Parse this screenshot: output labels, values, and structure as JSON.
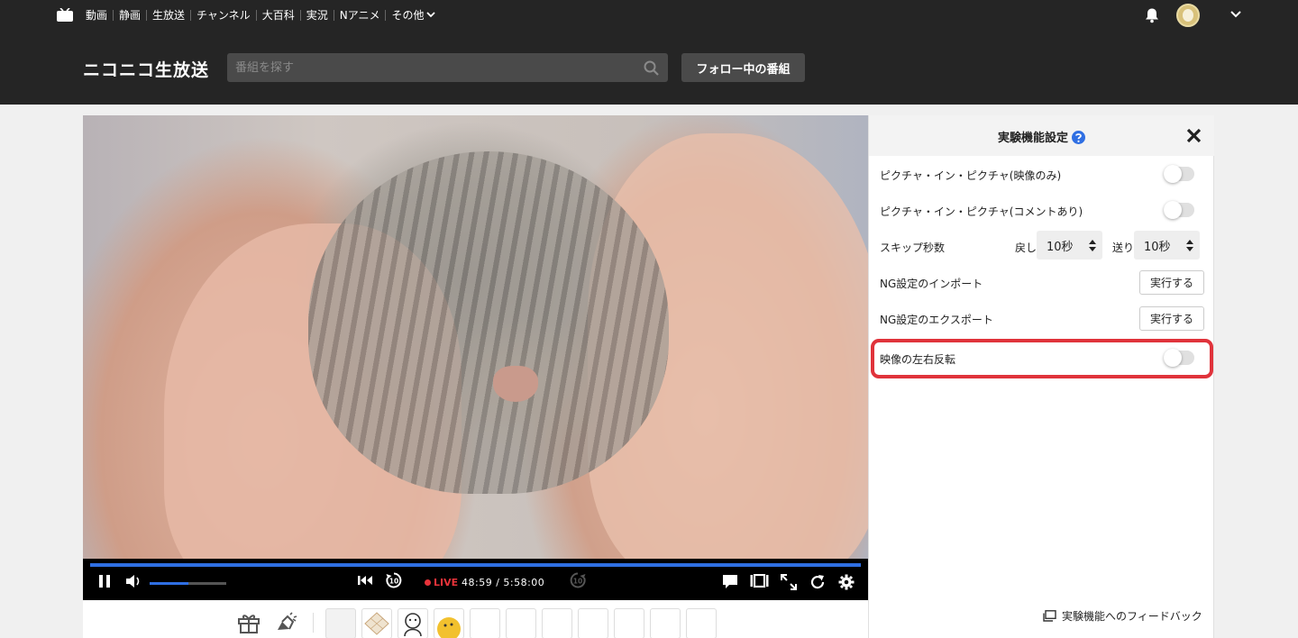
{
  "topnav": {
    "links": [
      "動画",
      "静画",
      "生放送",
      "チャンネル",
      "大百科",
      "実況",
      "Nアニメ"
    ],
    "more_label": "その他"
  },
  "header": {
    "logo": "ニコニコ生放送",
    "search_placeholder": "番組を探す",
    "follow_button": "フォロー中の番組"
  },
  "player": {
    "live_label": "LIVE",
    "timecode": "48:59 / 5:58:00",
    "progress": 1.0,
    "volume": 0.5
  },
  "settings": {
    "title": "実験機能設定",
    "rows": {
      "pip_video": {
        "label": "ピクチャ・イン・ピクチャ(映像のみ)",
        "enabled": false
      },
      "pip_comment": {
        "label": "ピクチャ・イン・ピクチャ(コメントあり)",
        "enabled": false
      },
      "skip": {
        "label": "スキップ秒数",
        "back_label": "戻し",
        "back_value": "10秒",
        "forward_label": "送り",
        "forward_value": "10秒"
      },
      "ng_import": {
        "label": "NG設定のインポート",
        "button": "実行する"
      },
      "ng_export": {
        "label": "NG設定のエクスポート",
        "button": "実行する"
      },
      "mirror": {
        "label": "映像の左右反転",
        "enabled": false
      }
    },
    "feedback_link": "実験機能へのフィードバック"
  },
  "colors": {
    "accent_blue": "#2f6fe3",
    "live_red": "#e8333a",
    "highlight_red": "#e0333b",
    "header_bg": "#252525"
  }
}
